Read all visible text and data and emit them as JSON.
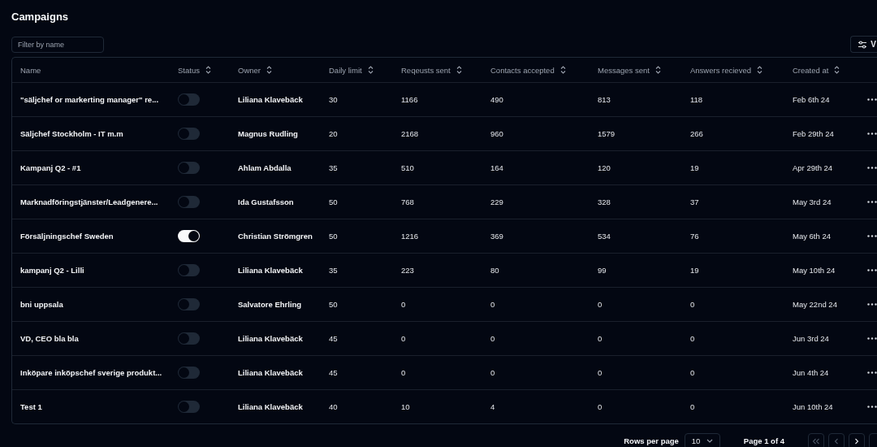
{
  "title": "Campaigns",
  "filter": {
    "placeholder": "Filter by name"
  },
  "view_button": {
    "label": "V"
  },
  "table": {
    "columns": [
      {
        "label": "Name",
        "sortable": false
      },
      {
        "label": "Status",
        "sortable": true
      },
      {
        "label": "Owner",
        "sortable": true
      },
      {
        "label": "Daily limit",
        "sortable": true
      },
      {
        "label": "Reqeusts sent",
        "sortable": true
      },
      {
        "label": "Contacts accepted",
        "sortable": true
      },
      {
        "label": "Messages sent",
        "sortable": true
      },
      {
        "label": "Answers recieved",
        "sortable": true
      },
      {
        "label": "Created at",
        "sortable": true
      }
    ],
    "rows": [
      {
        "name": "\"säljchef or markerting manager\" re...",
        "on": false,
        "owner": "Liliana Klavebäck",
        "daily_limit": "30",
        "requests": "1166",
        "contacts": "490",
        "messages": "813",
        "answers": "118",
        "created": "Feb 6th 24"
      },
      {
        "name": "Säljchef Stockholm - IT m.m",
        "on": false,
        "owner": "Magnus Rudling",
        "daily_limit": "20",
        "requests": "2168",
        "contacts": "960",
        "messages": "1579",
        "answers": "266",
        "created": "Feb 29th 24"
      },
      {
        "name": "Kampanj Q2 - #1",
        "on": false,
        "owner": "Ahlam Abdalla",
        "daily_limit": "35",
        "requests": "510",
        "contacts": "164",
        "messages": "120",
        "answers": "19",
        "created": "Apr 29th 24"
      },
      {
        "name": "Marknadföringstjänster/Leadgenere...",
        "on": false,
        "owner": "Ida Gustafsson",
        "daily_limit": "50",
        "requests": "768",
        "contacts": "229",
        "messages": "328",
        "answers": "37",
        "created": "May 3rd 24"
      },
      {
        "name": "Försäljningschef Sweden",
        "on": true,
        "owner": "Christian Strömgren",
        "daily_limit": "50",
        "requests": "1216",
        "contacts": "369",
        "messages": "534",
        "answers": "76",
        "created": "May 6th 24"
      },
      {
        "name": "kampanj Q2 - Lilli",
        "on": false,
        "owner": "Liliana Klavebäck",
        "daily_limit": "35",
        "requests": "223",
        "contacts": "80",
        "messages": "99",
        "answers": "19",
        "created": "May 10th 24"
      },
      {
        "name": "bni uppsala",
        "on": false,
        "owner": "Salvatore Ehrling",
        "daily_limit": "50",
        "requests": "0",
        "contacts": "0",
        "messages": "0",
        "answers": "0",
        "created": "May 22nd 24"
      },
      {
        "name": "VD, CEO bla bla",
        "on": false,
        "owner": "Liliana Klavebäck",
        "daily_limit": "45",
        "requests": "0",
        "contacts": "0",
        "messages": "0",
        "answers": "0",
        "created": "Jun 3rd 24"
      },
      {
        "name": "Inköpare inköpschef sverige produkt...",
        "on": false,
        "owner": "Liliana Klavebäck",
        "daily_limit": "45",
        "requests": "0",
        "contacts": "0",
        "messages": "0",
        "answers": "0",
        "created": "Jun 4th 24"
      },
      {
        "name": "Test 1",
        "on": false,
        "owner": "Liliana Klavebäck",
        "daily_limit": "40",
        "requests": "10",
        "contacts": "4",
        "messages": "0",
        "answers": "0",
        "created": "Jun 10th 24"
      }
    ]
  },
  "pagination": {
    "rows_per_page_label": "Rows per page",
    "rows_per_page": "10",
    "page_label": "Page 1 of 4"
  }
}
